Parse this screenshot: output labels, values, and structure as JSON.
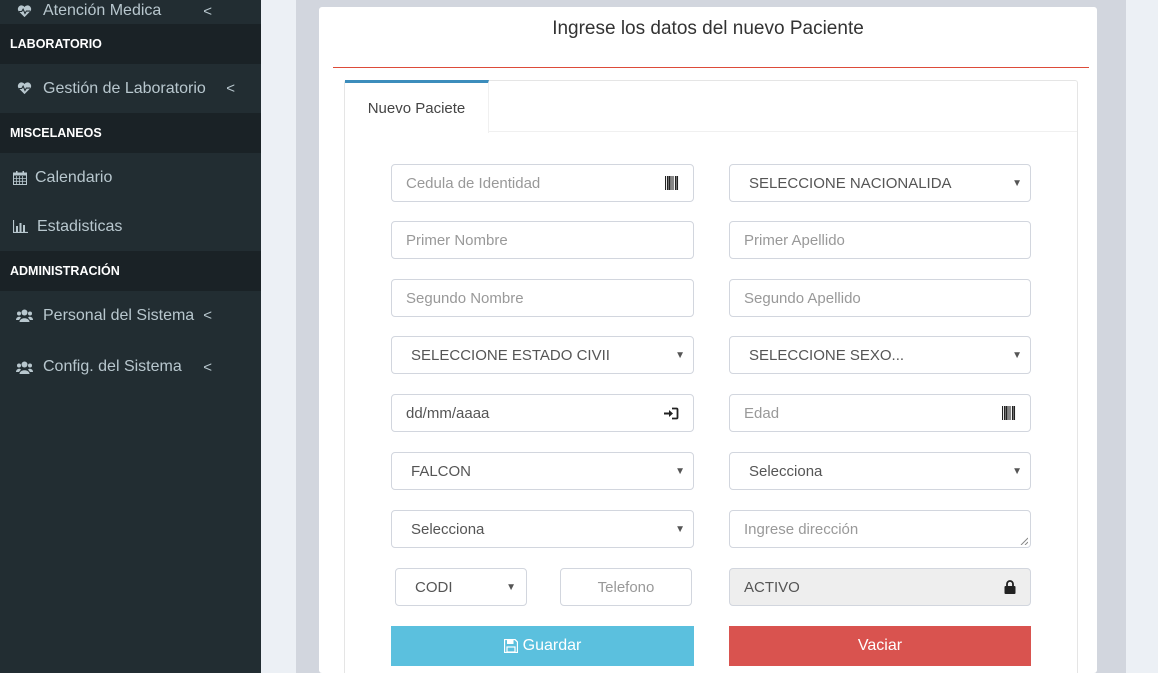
{
  "sidebar": {
    "items": [
      {
        "label": "Atención Medica",
        "icon": "heartbeat-icon"
      },
      {
        "header": "LABORATORIO"
      },
      {
        "label": "Gestión de Laboratorio",
        "icon": "heartbeat-icon"
      },
      {
        "header": "MISCELANEOS"
      },
      {
        "label": "Calendario",
        "icon": "calendar-icon"
      },
      {
        "label": "Estadisticas",
        "icon": "bar-chart-icon"
      },
      {
        "header": "ADMINISTRACIÓN"
      },
      {
        "label": "Personal del Sistema",
        "icon": "users-icon"
      },
      {
        "label": "Config. del Sistema",
        "icon": "users-icon"
      }
    ],
    "chevron": "<"
  },
  "form": {
    "title": "Ingrese los datos del nuevo Paciente",
    "tab": "Nuevo Paciete",
    "cedula_placeholder": "Cedula de Identidad",
    "nacionalidad": "SELECCIONE NACIONALIDA",
    "primer_nombre_placeholder": "Primer Nombre",
    "primer_apellido_placeholder": "Primer Apellido",
    "segundo_nombre_placeholder": "Segundo Nombre",
    "segundo_apellido_placeholder": "Segundo Apellido",
    "estado_civil": "SELECCIONE ESTADO CIVII",
    "sexo": "SELECCIONE SEXO...",
    "fecha": "dd/mm/aaaa",
    "edad_placeholder": "Edad",
    "estado": "FALCON",
    "municipio": "Selecciona",
    "parroquia": "Selecciona",
    "direccion_placeholder": "Ingrese dirección",
    "codigo": "CODI",
    "telefono_placeholder": "Telefono",
    "status": "ACTIVO",
    "save_label": "Guardar",
    "clear_label": "Vaciar"
  },
  "colors": {
    "sidebar_bg": "#222d32",
    "header_bg": "#1a2226",
    "accent": "#3c8dbc",
    "title_line": "#dd4b39",
    "save": "#5bc0de",
    "clear": "#d9534f"
  }
}
